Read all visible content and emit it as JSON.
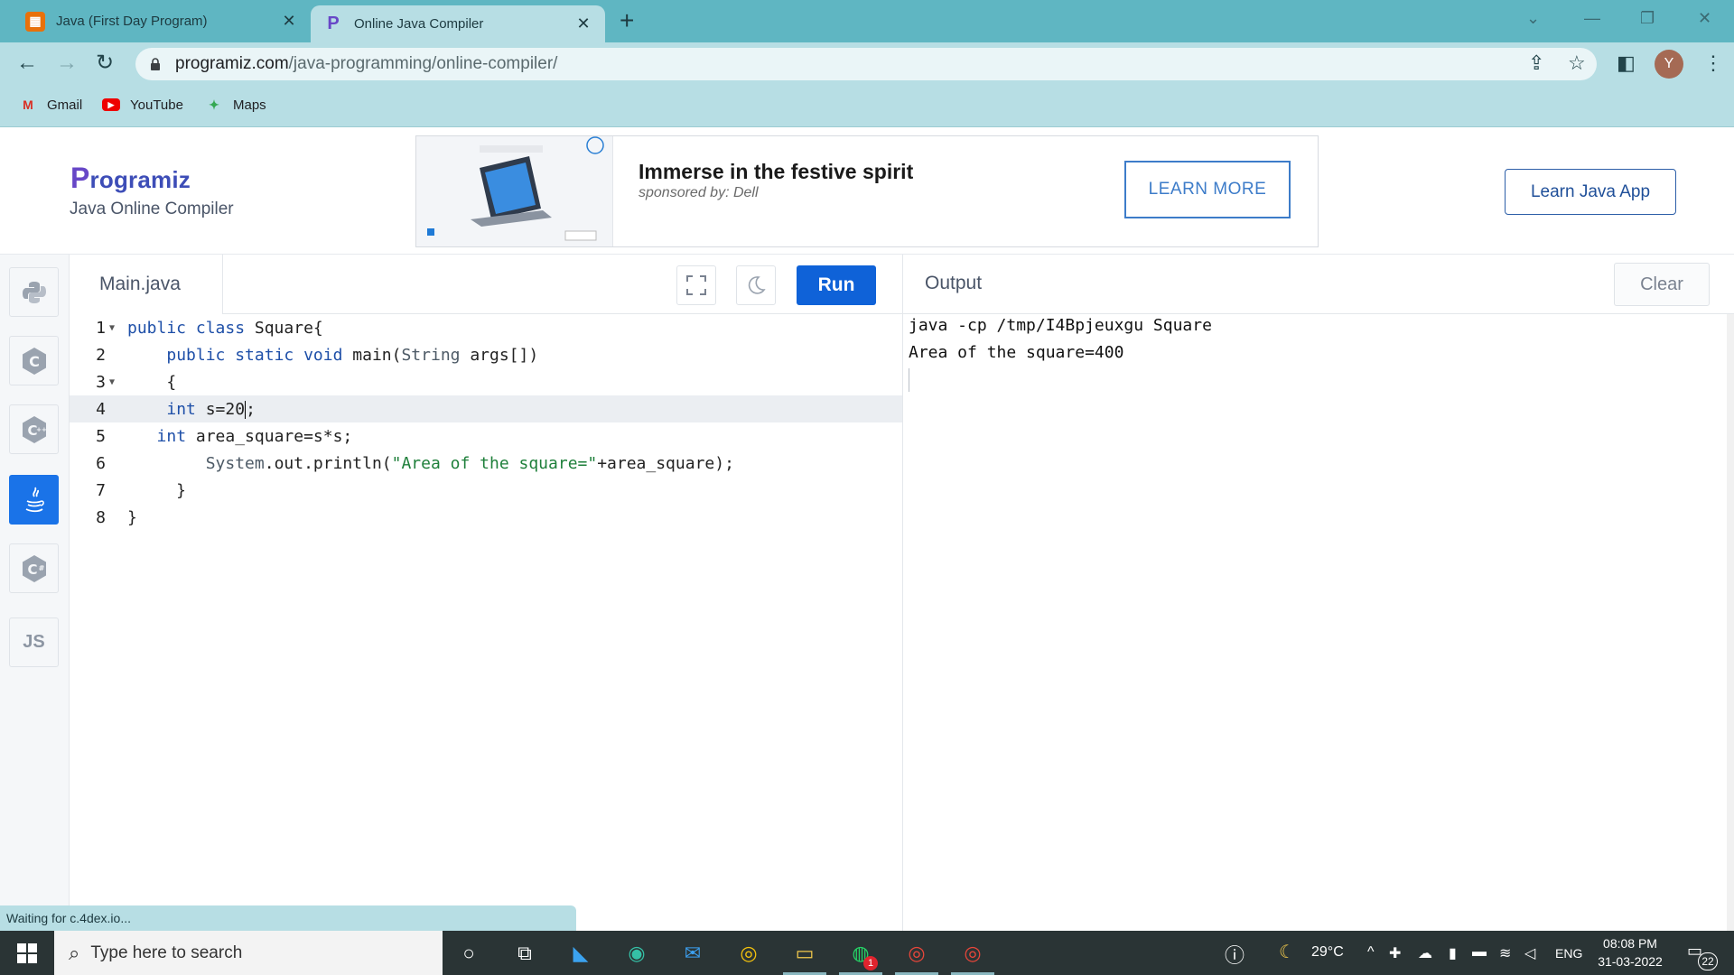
{
  "browser": {
    "tabs": [
      {
        "title": "Java (First Day Program)",
        "active": false
      },
      {
        "title": "Online Java Compiler",
        "active": true
      }
    ],
    "new_tab": "+",
    "url_host": "programiz.com",
    "url_path": "/java-programming/online-compiler/",
    "avatar_letter": "Y",
    "bookmarks": [
      {
        "label": "Gmail",
        "icon": "gmail-icon"
      },
      {
        "label": "YouTube",
        "icon": "youtube-icon"
      },
      {
        "label": "Maps",
        "icon": "maps-icon"
      }
    ]
  },
  "header": {
    "logo_p": "P",
    "logo_rest": "rogramiz",
    "subtitle": "Java Online Compiler",
    "ad": {
      "title": "Immerse in the festive spirit",
      "sponsor": "sponsored by: Dell",
      "button": "LEARN MORE"
    },
    "learn_app": "Learn Java App"
  },
  "sidebar": {
    "languages": [
      {
        "name": "python",
        "icon": "python-icon",
        "active": false
      },
      {
        "name": "c",
        "icon": "c-icon",
        "active": false
      },
      {
        "name": "cpp",
        "icon": "cpp-icon",
        "active": false
      },
      {
        "name": "java",
        "icon": "java-icon",
        "active": true
      },
      {
        "name": "csharp",
        "icon": "csharp-icon",
        "active": false
      },
      {
        "name": "js",
        "label": "JS",
        "active": false
      }
    ]
  },
  "editor": {
    "file_name": "Main.java",
    "run_label": "Run",
    "line_numbers": [
      "1",
      "2",
      "3",
      "4",
      "5",
      "6",
      "7",
      "8"
    ],
    "lines": [
      "public class Square{",
      "    public static void main(String args[])",
      "    {",
      "    int s=20;",
      "   int area_square=s*s;",
      "        System.out.println(\"Area of the square=\"+area_square);",
      "     }",
      "}"
    ],
    "highlighted_line": 4
  },
  "output": {
    "title": "Output",
    "clear_label": "Clear",
    "lines": [
      "java -cp /tmp/I4Bpjeuxgu Square",
      "Area of the square=400"
    ]
  },
  "status": {
    "text": "Waiting for c.4dex.io..."
  },
  "taskbar": {
    "search_placeholder": "Type here to search",
    "weather": "29°C",
    "language": "ENG",
    "time": "08:08 PM",
    "date": "31-03-2022",
    "notifications": "22",
    "whatsapp_badge": "1"
  },
  "colors": {
    "chrome_tab_strip": "#5fb6c2",
    "chrome_toolbar": "#b7dee4",
    "run_button": "#0f62d8",
    "active_language": "#1a73e8"
  }
}
